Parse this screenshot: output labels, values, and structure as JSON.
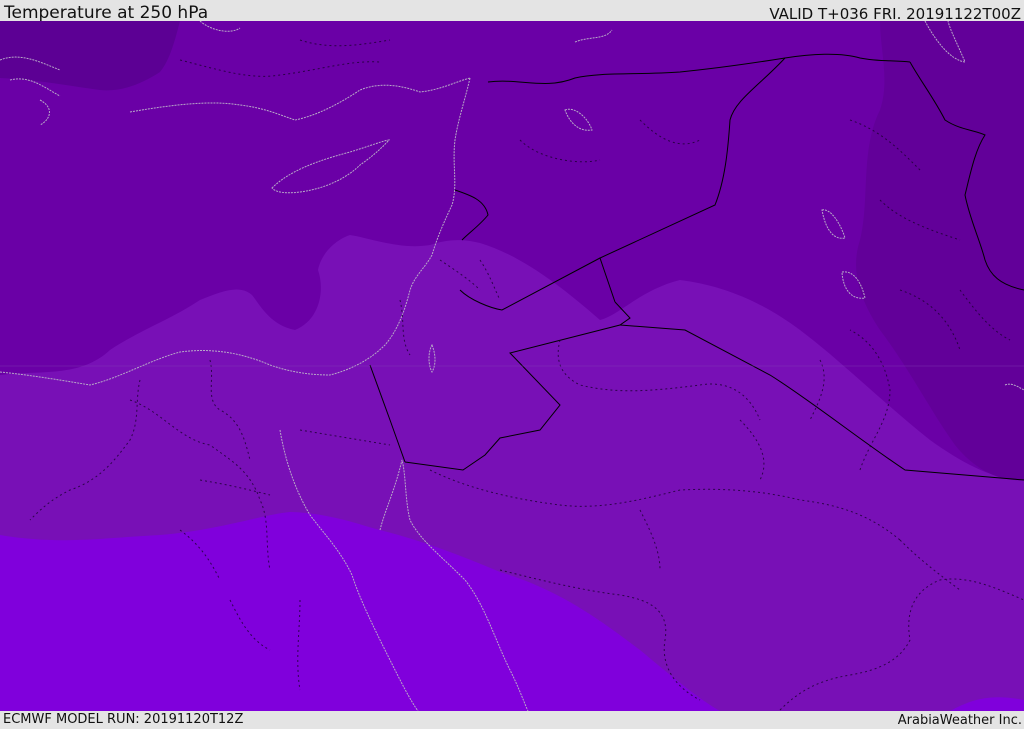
{
  "header": {
    "title": "Temperature at 250 hPa",
    "valid": "VALID T+036 FRI. 20191122T00Z"
  },
  "footer": {
    "model_run": "ECMWF MODEL RUN: 20191120T12Z",
    "credit": "ArabiaWeather Inc."
  },
  "colors": {
    "coldest_band": "#5c0094",
    "cold_band": "#6a00a6",
    "mid_band": "#7810b6",
    "warm_band": "#8000dc",
    "coastline": "#b8a8c8",
    "border": "#000000"
  }
}
